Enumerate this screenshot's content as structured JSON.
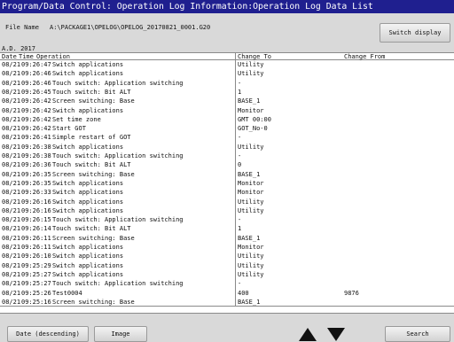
{
  "window": {
    "title": "Program/Data Control: Operation Log Information:Operation Log Data List"
  },
  "file": {
    "label": "File Name",
    "path": "A:\\PACKAGE1\\OPELOG\\OPELOG_20170821_0001.G20"
  },
  "toolbar": {
    "switch_display_label": "Switch display"
  },
  "year_label": "A.D. 2017",
  "table": {
    "headers": {
      "date": "Date",
      "time": "Time",
      "operation": "Operation",
      "change_to": "Change To",
      "change_from": "Change From"
    },
    "rows": [
      {
        "date": "08/21",
        "time": "09:26:47",
        "operation": "Switch applications",
        "change_to": "Utility"
      },
      {
        "date": "08/21",
        "time": "09:26:46",
        "operation": "Switch applications",
        "change_to": "Utility"
      },
      {
        "date": "08/21",
        "time": "09:26:46",
        "operation": "Touch switch: Application switching",
        "change_to": "-"
      },
      {
        "date": "08/21",
        "time": "09:26:45",
        "operation": "Touch switch: Bit ALT",
        "change_to": "1"
      },
      {
        "date": "08/21",
        "time": "09:26:42",
        "operation": "Screen switching: Base",
        "change_to": "BASE_1"
      },
      {
        "date": "08/21",
        "time": "09:26:42",
        "operation": "Switch applications",
        "change_to": "Monitor"
      },
      {
        "date": "08/21",
        "time": "09:26:42",
        "operation": "Set time zone",
        "change_to": "GMT 00:00"
      },
      {
        "date": "08/21",
        "time": "09:26:42",
        "operation": "Start GOT",
        "change_to": "GOT_No-0"
      },
      {
        "date": "08/21",
        "time": "09:26:41",
        "operation": "Simple restart of GOT",
        "change_to": "-"
      },
      {
        "date": "08/21",
        "time": "09:26:38",
        "operation": "Switch applications",
        "change_to": "Utility"
      },
      {
        "date": "08/21",
        "time": "09:26:38",
        "operation": "Touch switch: Application switching",
        "change_to": "-"
      },
      {
        "date": "08/21",
        "time": "09:26:36",
        "operation": "Touch switch: Bit ALT",
        "change_to": "0"
      },
      {
        "date": "08/21",
        "time": "09:26:35",
        "operation": "Screen switching: Base",
        "change_to": "BASE_1"
      },
      {
        "date": "08/21",
        "time": "09:26:35",
        "operation": "Switch applications",
        "change_to": "Monitor"
      },
      {
        "date": "08/21",
        "time": "09:26:33",
        "operation": "Switch applications",
        "change_to": "Monitor"
      },
      {
        "date": "08/21",
        "time": "09:26:16",
        "operation": "Switch applications",
        "change_to": "Utility"
      },
      {
        "date": "08/21",
        "time": "09:26:16",
        "operation": "Switch applications",
        "change_to": "Utility"
      },
      {
        "date": "08/21",
        "time": "09:26:15",
        "operation": "Touch switch: Application switching",
        "change_to": "-"
      },
      {
        "date": "08/21",
        "time": "09:26:14",
        "operation": "Touch switch: Bit ALT",
        "change_to": "1"
      },
      {
        "date": "08/21",
        "time": "09:26:11",
        "operation": "Screen switching: Base",
        "change_to": "BASE_1"
      },
      {
        "date": "08/21",
        "time": "09:26:11",
        "operation": "Switch applications",
        "change_to": "Monitor"
      },
      {
        "date": "08/21",
        "time": "09:26:10",
        "operation": "Switch applications",
        "change_to": "Utility"
      },
      {
        "date": "08/21",
        "time": "09:25:29",
        "operation": "Switch applications",
        "change_to": "Utility"
      },
      {
        "date": "08/21",
        "time": "09:25:27",
        "operation": "Switch applications",
        "change_to": "Utility"
      },
      {
        "date": "08/21",
        "time": "09:25:27",
        "operation": "Touch switch: Application switching",
        "change_to": "-"
      },
      {
        "date": "08/21",
        "time": "09:25:26",
        "operation": "Test0004",
        "change_to": "400",
        "change_from": "9876"
      },
      {
        "date": "08/21",
        "time": "09:25:16",
        "operation": "Screen switching: Base",
        "change_to": "BASE_1"
      }
    ]
  },
  "footer": {
    "sort_label": "Date (descending)",
    "image_label": "Image",
    "search_label": "Search",
    "scroll_up_icon": "triangle-up-icon",
    "scroll_down_icon": "triangle-down-icon"
  },
  "colors": {
    "title_bar": "#1f1f8f",
    "title_text": "#ffffff",
    "background": "#d9d9d9",
    "table_background": "#ffffff"
  }
}
